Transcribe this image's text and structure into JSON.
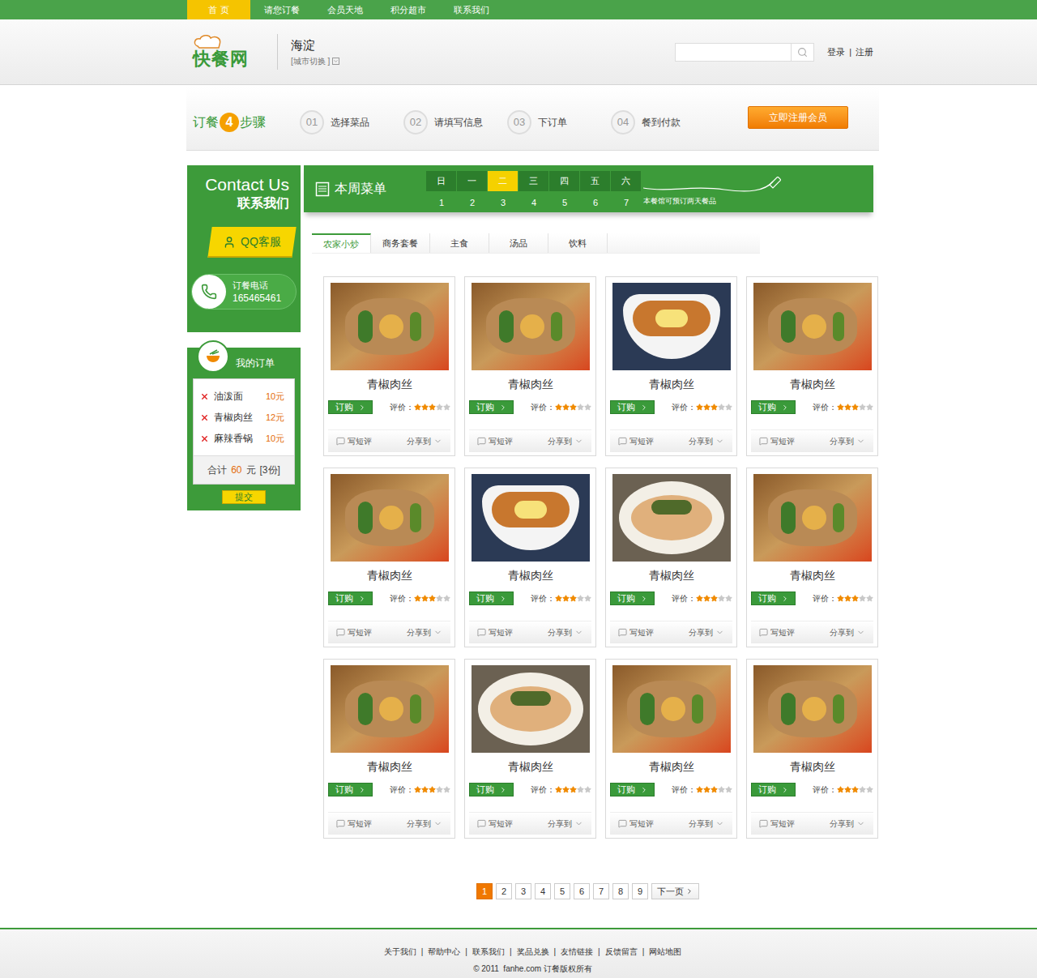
{
  "nav": [
    {
      "label": "首 页",
      "selected": true
    },
    {
      "label": "请您订餐",
      "selected": false
    },
    {
      "label": "会员天地",
      "selected": false
    },
    {
      "label": "积分超市",
      "selected": false
    },
    {
      "label": "联系我们",
      "selected": false
    }
  ],
  "logo": {
    "text": "快餐网"
  },
  "city": {
    "name": "海淀",
    "switch": "[城市切换 ]"
  },
  "auth": {
    "login": "登录",
    "separator": "|",
    "register": "注册"
  },
  "steps": {
    "title_before": "订餐",
    "number": "4",
    "title_after": "步骤",
    "items": [
      {
        "number": "01",
        "label": "选择菜品"
      },
      {
        "number": "02",
        "label": "请填写信息"
      },
      {
        "number": "03",
        "label": "下订单"
      },
      {
        "number": "04",
        "label": "餐到付款"
      }
    ],
    "register_button": "立即注册会员"
  },
  "contact": {
    "title_en": "Contact Us",
    "title_zh": "联系我们",
    "qq": "QQ客服",
    "phone_label": "订餐电话",
    "phone": "165465461"
  },
  "order": {
    "title": "我的订单",
    "items": [
      {
        "name": "油泼面",
        "price": "10元"
      },
      {
        "name": "青椒肉丝",
        "price": "12元"
      },
      {
        "name": "麻辣香锅",
        "price": "10元"
      }
    ],
    "total_label": "合计",
    "total": "60",
    "total_unit": "元",
    "count": "[3份]",
    "submit": "提交"
  },
  "menu": {
    "title": "本周菜单",
    "days": [
      {
        "label": "日",
        "date": "1",
        "selected": false
      },
      {
        "label": "一",
        "date": "2",
        "selected": false
      },
      {
        "label": "二",
        "date": "3",
        "selected": true
      },
      {
        "label": "三",
        "date": "4",
        "selected": false
      },
      {
        "label": "四",
        "date": "5",
        "selected": false
      },
      {
        "label": "五",
        "date": "6",
        "selected": false
      },
      {
        "label": "六",
        "date": "7",
        "selected": false
      }
    ],
    "note": "本餐馆可预订两天餐品"
  },
  "categories": [
    {
      "label": "农家小炒",
      "selected": true
    },
    {
      "label": "商务套餐",
      "selected": false
    },
    {
      "label": "主食",
      "selected": false
    },
    {
      "label": "汤品",
      "selected": false
    },
    {
      "label": "饮料",
      "selected": false
    }
  ],
  "card": {
    "order": "订购",
    "rating_label": "评价：",
    "review": "写短评",
    "share": "分享到",
    "stars_max": 5
  },
  "dishes": [
    {
      "name": "青椒肉丝",
      "kind": "stir-fry",
      "stars": 3
    },
    {
      "name": "青椒肉丝",
      "kind": "stir-fry",
      "stars": 3
    },
    {
      "name": "青椒肉丝",
      "kind": "rice-bowl",
      "stars": 3
    },
    {
      "name": "青椒肉丝",
      "kind": "stir-fry",
      "stars": 3
    },
    {
      "name": "青椒肉丝",
      "kind": "stir-fry",
      "stars": 3
    },
    {
      "name": "青椒肉丝",
      "kind": "rice-bowl",
      "stars": 3
    },
    {
      "name": "青椒肉丝",
      "kind": "noodles",
      "stars": 3
    },
    {
      "name": "青椒肉丝",
      "kind": "stir-fry",
      "stars": 3
    },
    {
      "name": "青椒肉丝",
      "kind": "stir-fry",
      "stars": 3
    },
    {
      "name": "青椒肉丝",
      "kind": "noodles",
      "stars": 3
    },
    {
      "name": "青椒肉丝",
      "kind": "stir-fry",
      "stars": 3
    },
    {
      "name": "青椒肉丝",
      "kind": "stir-fry",
      "stars": 3
    }
  ],
  "pagination": {
    "pages": [
      {
        "label": "1",
        "selected": true
      },
      {
        "label": "2",
        "selected": false
      },
      {
        "label": "3",
        "selected": false
      },
      {
        "label": "4",
        "selected": false
      },
      {
        "label": "5",
        "selected": false
      },
      {
        "label": "6",
        "selected": false
      },
      {
        "label": "7",
        "selected": false
      },
      {
        "label": "8",
        "selected": false
      },
      {
        "label": "9",
        "selected": false
      }
    ],
    "next": "下一页"
  },
  "footer": {
    "links": [
      "关于我们",
      "帮助中心",
      "联系我们",
      "奖品兑换",
      "友情链接",
      "反馈留言",
      "网站地图"
    ],
    "separator": "|",
    "copyright": "© 2011  fanhe.com 订餐版权所有"
  }
}
